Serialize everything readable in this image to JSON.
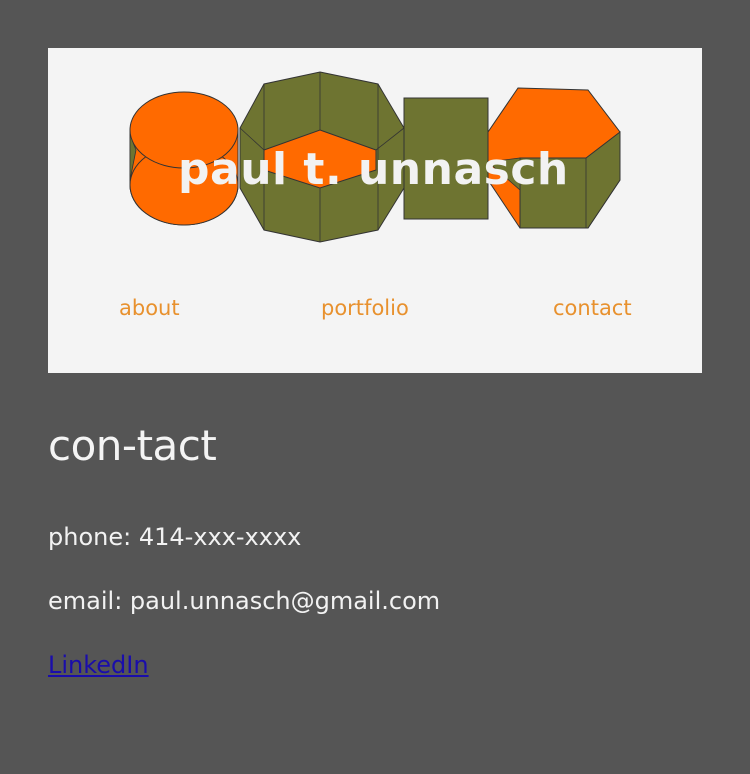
{
  "header": {
    "logo_text": "paul t. unnasch",
    "colors": {
      "card_background": "#f4f4f4",
      "logo_orange": "#ff6a00",
      "logo_olive": "#6e7431",
      "nav_link": "#e8912e"
    },
    "nav": [
      {
        "label": "about"
      },
      {
        "label": "portfolio"
      },
      {
        "label": "contact"
      }
    ]
  },
  "main": {
    "title": "con-tact",
    "phone": "phone: 414-xxx-xxxx",
    "email": "email: paul.unnasch@gmail.com",
    "linkedin_label": "LinkedIn"
  },
  "page": {
    "background": "#555555",
    "link_color": "#1a0dab"
  }
}
